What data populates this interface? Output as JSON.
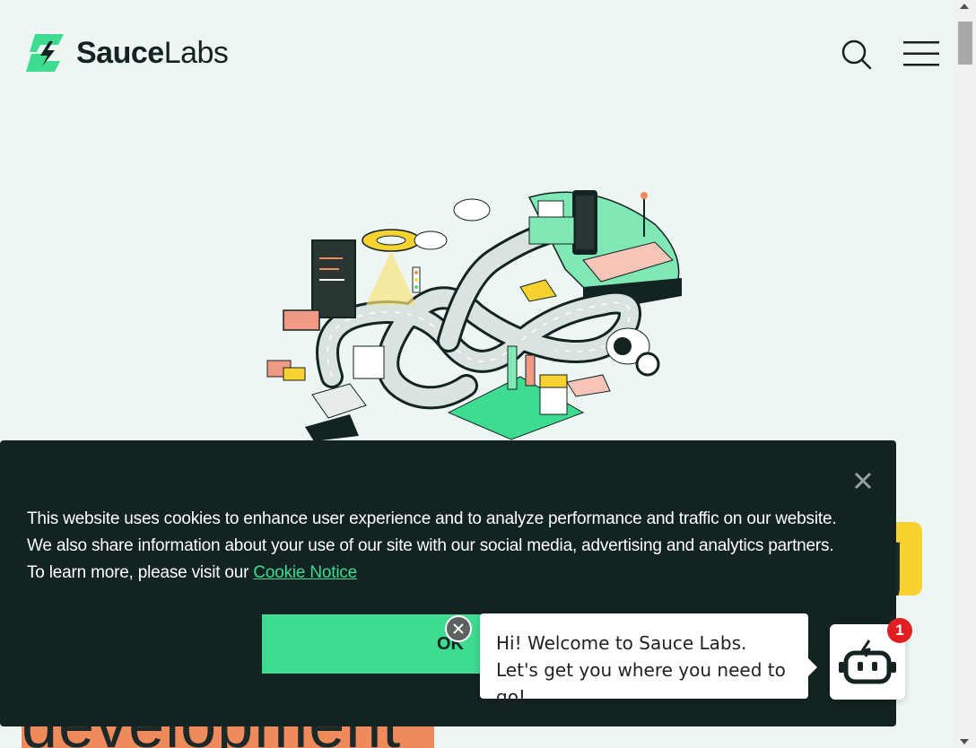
{
  "header": {
    "logo_bold": "Sauce",
    "logo_light": "Labs",
    "search_icon": "search-icon",
    "menu_icon": "hamburger-menu-icon"
  },
  "background": {
    "yellow_letter": "g",
    "orange_word": "development"
  },
  "cookie_banner": {
    "text": "This website uses cookies to enhance user experience and to analyze performance and traffic on our website. We also share information about your use of our site with our social media, advertising and analytics partners. To learn more, please visit our ",
    "link_label": "Cookie Notice",
    "ok_label": "OK",
    "close_icon": "close-icon"
  },
  "chat": {
    "message": "Hi! Welcome to Sauce Labs. Let's get you where you need to go!",
    "badge_count": "1",
    "bot_icon": "robot-icon",
    "close_icon": "close-icon"
  },
  "colors": {
    "page_bg": "#eef6f4",
    "brand_green": "#3ddc91",
    "banner_bg": "#132322",
    "accent_yellow": "#f8d230",
    "accent_orange": "#ef8a5d",
    "badge_red": "#e02020"
  }
}
